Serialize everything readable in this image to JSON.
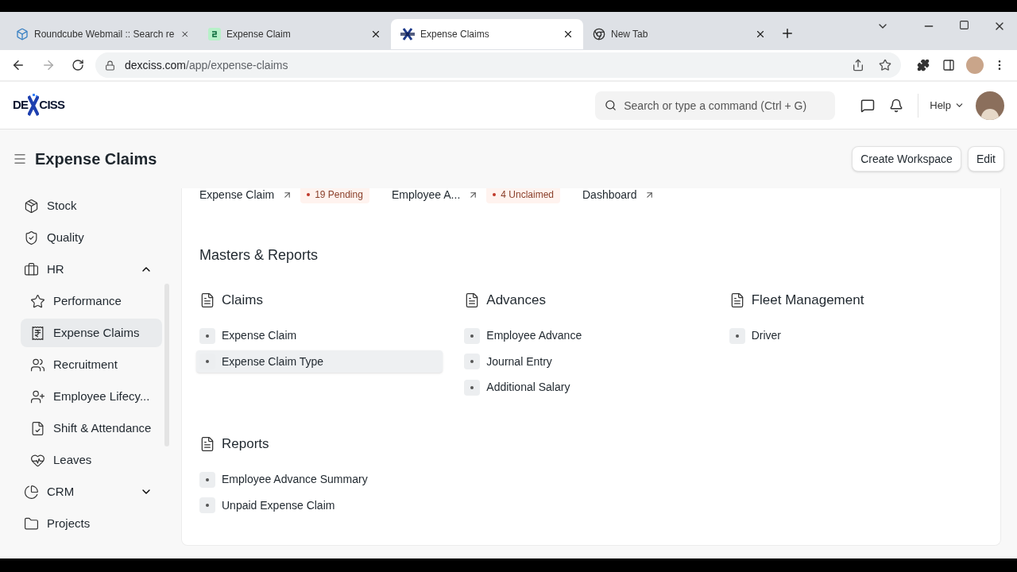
{
  "browser": {
    "tabs": [
      {
        "title": "Roundcube Webmail :: Search re",
        "selected": false
      },
      {
        "title": "Expense Claim",
        "selected": false
      },
      {
        "title": "Expense Claims",
        "selected": true
      },
      {
        "title": "New Tab",
        "selected": false
      }
    ],
    "url_host": "dexciss.com",
    "url_path": "/app/expense-claims"
  },
  "app": {
    "logo_left": "DE",
    "logo_right": "CISS",
    "search": {
      "placeholder": "Search or type a command (Ctrl + G)"
    },
    "help": "Help"
  },
  "page": {
    "title": "Expense Claims",
    "buttons": [
      "Create Workspace",
      "Edit"
    ]
  },
  "sidebar": {
    "items": [
      {
        "label": "Stock"
      },
      {
        "label": "Quality"
      },
      {
        "label": "HR",
        "expanded": true,
        "children": [
          {
            "label": "Performance",
            "selected": false
          },
          {
            "label": "Expense Claims",
            "selected": true
          },
          {
            "label": "Recruitment",
            "selected": false
          },
          {
            "label": "Employee Lifecy...",
            "selected": false
          },
          {
            "label": "Shift & Attendance",
            "selected": false
          },
          {
            "label": "Leaves",
            "selected": false
          }
        ]
      },
      {
        "label": "CRM",
        "expanded": false
      },
      {
        "label": "Projects"
      }
    ]
  },
  "shortcuts": [
    {
      "label": "Expense Claim",
      "badge": "19 Pending"
    },
    {
      "label": "Employee A...",
      "badge": "4 Unclaimed"
    },
    {
      "label": "Dashboard"
    }
  ],
  "sections": [
    {
      "title": "Masters & Reports",
      "cards": [
        {
          "title": "Claims",
          "links": [
            {
              "label": "Expense Claim",
              "hovered": false
            },
            {
              "label": "Expense Claim Type",
              "hovered": true
            }
          ]
        },
        {
          "title": "Advances",
          "links": [
            {
              "label": "Employee Advance",
              "hovered": false
            },
            {
              "label": "Journal Entry",
              "hovered": false
            },
            {
              "label": "Additional Salary",
              "hovered": false
            }
          ]
        },
        {
          "title": "Fleet Management",
          "links": [
            {
              "label": "Driver",
              "hovered": false
            }
          ]
        },
        {
          "title": "Reports",
          "links": [
            {
              "label": "Employee Advance Summary",
              "hovered": false
            },
            {
              "label": "Unpaid Expense Claim",
              "hovered": false
            }
          ]
        }
      ]
    }
  ]
}
